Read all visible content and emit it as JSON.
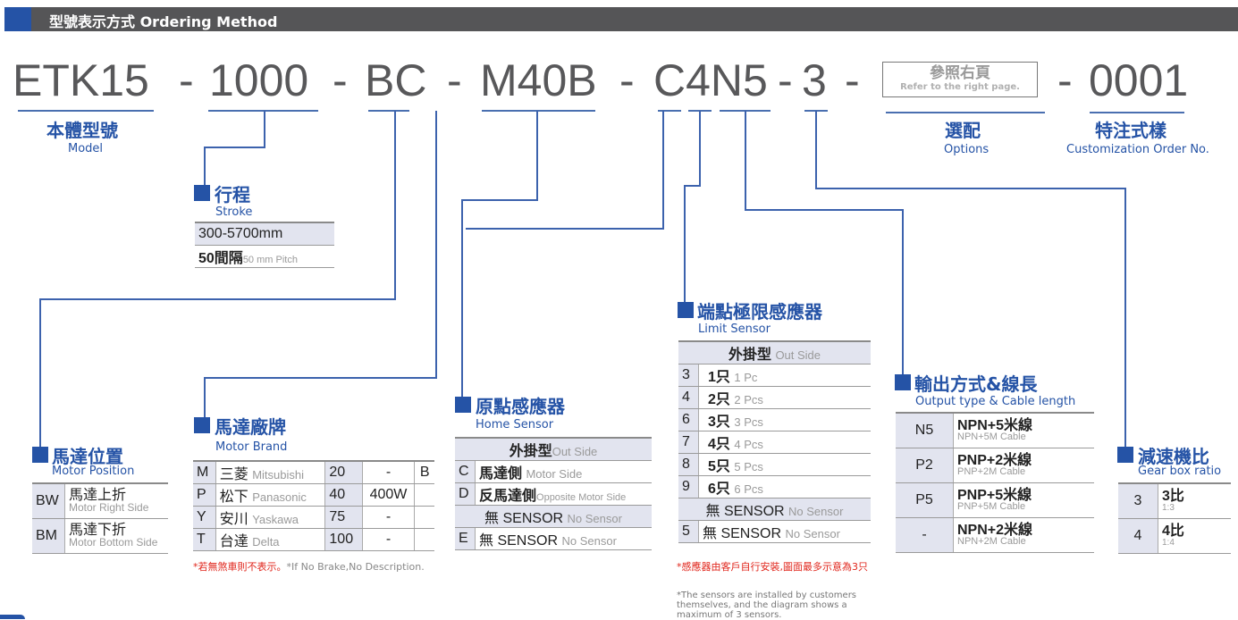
{
  "header": {
    "title": "型號表示方式 Ordering Method"
  },
  "code": {
    "segments": [
      "ETK15",
      "-",
      "1000",
      "-",
      "BC",
      "-",
      "M40B",
      "-",
      "C4N5",
      "-",
      "3",
      "-"
    ],
    "suffix_dash": "-",
    "suffix": "0001"
  },
  "options_box": {
    "cn": "參照右頁",
    "en": "Refer to the right page."
  },
  "model": {
    "cn": "本體型號",
    "en": "Model"
  },
  "options": {
    "cn": "選配",
    "en": "Options"
  },
  "customization": {
    "cn": "特注式樣",
    "en": "Customization Order No."
  },
  "stroke": {
    "cn": "行程",
    "en": "Stroke",
    "range": "300-5700mm",
    "pitch_cn": "50間隔",
    "pitch_en": "50 mm Pitch"
  },
  "motor_position": {
    "cn": "馬達位置",
    "en": "Motor Position",
    "rows": [
      {
        "code": "BW",
        "cn": "馬達上折",
        "en": "Motor Right Side"
      },
      {
        "code": "BM",
        "cn": "馬達下折",
        "en": "Motor Bottom Side"
      }
    ]
  },
  "motor_brand": {
    "cn": "馬達廠牌",
    "en": "Motor Brand",
    "rows": [
      {
        "code": "M",
        "cn": "三菱",
        "en": "Mitsubishi",
        "size": "20",
        "power": "-",
        "brake": "B"
      },
      {
        "code": "P",
        "cn": "松下",
        "en": "Panasonic",
        "size": "40",
        "power": "400W",
        "brake": ""
      },
      {
        "code": "Y",
        "cn": "安川",
        "en": "Yaskawa",
        "size": "75",
        "power": "-",
        "brake": ""
      },
      {
        "code": "T",
        "cn": "台達",
        "en": "Delta",
        "size": "100",
        "power": "-",
        "brake": ""
      }
    ],
    "note_cn": "*若無煞車則不表示。",
    "note_en": "*If No Brake,No Description."
  },
  "home_sensor": {
    "cn": "原點感應器",
    "en": "Home Sensor",
    "group1_cn": "外掛型",
    "group1_en": "Out Side",
    "rows1": [
      {
        "code": "C",
        "cn": "馬達側",
        "en": "Motor Side"
      },
      {
        "code": "D",
        "cn": "反馬達側",
        "en": "Opposite Motor Side"
      }
    ],
    "group2_cn": "無 SENSOR",
    "group2_en": "No Sensor",
    "rows2": [
      {
        "code": "E",
        "cn": "無 SENSOR",
        "en": "No Sensor"
      }
    ]
  },
  "limit_sensor": {
    "cn": "端點極限感應器",
    "en": "Limit Sensor",
    "group1_cn": "外掛型",
    "group1_en": "Out Side",
    "rows1": [
      {
        "code": "3",
        "cn": "1只",
        "en": "1 Pc"
      },
      {
        "code": "4",
        "cn": "2只",
        "en": "2 Pcs"
      },
      {
        "code": "6",
        "cn": "3只",
        "en": "3 Pcs"
      },
      {
        "code": "7",
        "cn": "4只",
        "en": "4 Pcs"
      },
      {
        "code": "8",
        "cn": "5只",
        "en": "5 Pcs"
      },
      {
        "code": "9",
        "cn": "6只",
        "en": "6 Pcs"
      }
    ],
    "group2_cn": "無 SENSOR",
    "group2_en": "No Sensor",
    "rows2": [
      {
        "code": "5",
        "cn": "無 SENSOR",
        "en": "No Sensor"
      }
    ],
    "note_cn": "*感應器由客戶自行安裝,圖面最多示意為3只",
    "note_en": "*The sensors are installed by customers themselves, and the diagram shows a maximum of 3 sensors."
  },
  "output": {
    "cn": "輸出方式&線長",
    "en": "Output type & Cable length",
    "rows": [
      {
        "code": "N5",
        "cn": "NPN+5米線",
        "en": "NPN+5M Cable"
      },
      {
        "code": "P2",
        "cn": "PNP+2米線",
        "en": "PNP+2M Cable"
      },
      {
        "code": "P5",
        "cn": "PNP+5米線",
        "en": "PNP+5M Cable"
      },
      {
        "code": "-",
        "cn": "NPN+2米線",
        "en": "NPN+2M Cable"
      }
    ]
  },
  "gear": {
    "cn": "減速機比",
    "en": "Gear box ratio",
    "rows": [
      {
        "code": "3",
        "cn": "3比",
        "en": "1:3"
      },
      {
        "code": "4",
        "cn": "4比",
        "en": "1:4"
      }
    ]
  }
}
